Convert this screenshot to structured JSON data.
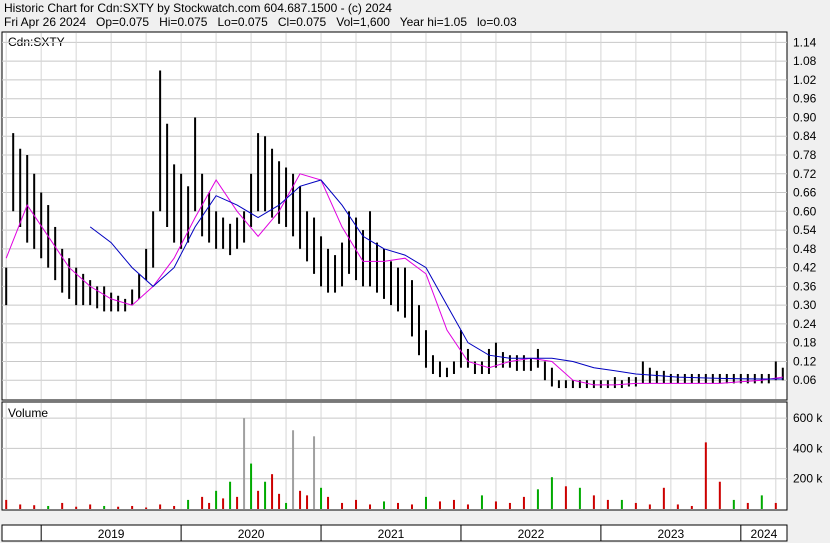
{
  "header": {
    "line1": "Historic Chart for Cdn:SXTY by Stockwatch.com 604.687.1500 - (c) 2024",
    "line2": "Fri Apr 26 2024   Op=0.075   Hi=0.075   Lo=0.075   Cl=0.075   Vol=1,600   Year hi=1.05   lo=0.03"
  },
  "chart_data": [
    {
      "type": "line",
      "title": "Cdn:SXTY",
      "ylim": [
        0.0,
        1.17
      ],
      "y_ticks": [
        "1.14",
        "1.08",
        "1.02",
        "0.96",
        "0.90",
        "0.84",
        "0.78",
        "0.72",
        "0.66",
        "0.60",
        "0.54",
        "0.48",
        "0.42",
        "0.36",
        "0.30",
        "0.24",
        "0.18",
        "0.12",
        "0.06"
      ],
      "x_ticks": [
        "2019",
        "2020",
        "2021",
        "2022",
        "2023",
        "2024"
      ],
      "x_range_years": [
        2018.72,
        2024.33
      ],
      "grid": true,
      "series": [
        {
          "style": "ohlc-bar",
          "color": "#000000",
          "x": [
            2018.75,
            2018.8,
            2018.85,
            2018.9,
            2018.95,
            2019.0,
            2019.05,
            2019.1,
            2019.15,
            2019.2,
            2019.25,
            2019.3,
            2019.35,
            2019.4,
            2019.45,
            2019.5,
            2019.55,
            2019.6,
            2019.65,
            2019.7,
            2019.75,
            2019.8,
            2019.85,
            2019.9,
            2019.95,
            2020.0,
            2020.05,
            2020.1,
            2020.15,
            2020.2,
            2020.25,
            2020.3,
            2020.35,
            2020.4,
            2020.45,
            2020.5,
            2020.55,
            2020.6,
            2020.65,
            2020.7,
            2020.75,
            2020.8,
            2020.85,
            2020.9,
            2020.95,
            2021.0,
            2021.05,
            2021.1,
            2021.15,
            2021.2,
            2021.25,
            2021.3,
            2021.35,
            2021.4,
            2021.45,
            2021.5,
            2021.55,
            2021.6,
            2021.65,
            2021.7,
            2021.75,
            2021.8,
            2021.85,
            2021.9,
            2021.95,
            2022.0,
            2022.05,
            2022.1,
            2022.15,
            2022.2,
            2022.25,
            2022.3,
            2022.35,
            2022.4,
            2022.45,
            2022.5,
            2022.55,
            2022.6,
            2022.65,
            2022.7,
            2022.75,
            2022.8,
            2022.85,
            2022.9,
            2022.95,
            2023.0,
            2023.05,
            2023.1,
            2023.15,
            2023.2,
            2023.25,
            2023.3,
            2023.35,
            2023.4,
            2023.45,
            2023.5,
            2023.55,
            2023.6,
            2023.65,
            2023.7,
            2023.75,
            2023.8,
            2023.85,
            2023.9,
            2023.95,
            2024.0,
            2024.05,
            2024.1,
            2024.15,
            2024.2,
            2024.25,
            2024.3
          ],
          "high": [
            0.42,
            0.85,
            0.8,
            0.78,
            0.72,
            0.66,
            0.62,
            0.55,
            0.48,
            0.45,
            0.42,
            0.4,
            0.38,
            0.36,
            0.36,
            0.34,
            0.33,
            0.32,
            0.35,
            0.4,
            0.48,
            0.6,
            1.05,
            0.88,
            0.75,
            0.72,
            0.68,
            0.9,
            0.72,
            0.66,
            0.6,
            0.58,
            0.56,
            0.58,
            0.6,
            0.72,
            0.85,
            0.84,
            0.8,
            0.76,
            0.74,
            0.72,
            0.68,
            0.6,
            0.58,
            0.52,
            0.48,
            0.46,
            0.5,
            0.6,
            0.58,
            0.54,
            0.6,
            0.5,
            0.48,
            0.44,
            0.42,
            0.42,
            0.38,
            0.3,
            0.22,
            0.14,
            0.12,
            0.1,
            0.12,
            0.22,
            0.16,
            0.12,
            0.12,
            0.16,
            0.18,
            0.15,
            0.14,
            0.14,
            0.14,
            0.13,
            0.16,
            0.12,
            0.1,
            0.06,
            0.06,
            0.06,
            0.06,
            0.06,
            0.06,
            0.06,
            0.06,
            0.07,
            0.06,
            0.07,
            0.07,
            0.12,
            0.1,
            0.09,
            0.09,
            0.08,
            0.08,
            0.08,
            0.08,
            0.08,
            0.08,
            0.08,
            0.08,
            0.08,
            0.08,
            0.08,
            0.08,
            0.08,
            0.08,
            0.08,
            0.12,
            0.1
          ],
          "low": [
            0.3,
            0.6,
            0.55,
            0.5,
            0.48,
            0.45,
            0.42,
            0.38,
            0.34,
            0.32,
            0.3,
            0.3,
            0.3,
            0.29,
            0.28,
            0.28,
            0.28,
            0.28,
            0.3,
            0.32,
            0.38,
            0.42,
            0.6,
            0.55,
            0.5,
            0.48,
            0.5,
            0.6,
            0.52,
            0.5,
            0.48,
            0.48,
            0.46,
            0.48,
            0.5,
            0.55,
            0.6,
            0.6,
            0.58,
            0.56,
            0.55,
            0.52,
            0.48,
            0.44,
            0.4,
            0.36,
            0.34,
            0.34,
            0.36,
            0.4,
            0.38,
            0.36,
            0.36,
            0.34,
            0.32,
            0.3,
            0.28,
            0.26,
            0.2,
            0.14,
            0.1,
            0.08,
            0.07,
            0.07,
            0.08,
            0.1,
            0.1,
            0.08,
            0.08,
            0.08,
            0.1,
            0.1,
            0.1,
            0.09,
            0.09,
            0.09,
            0.1,
            0.06,
            0.04,
            0.035,
            0.035,
            0.035,
            0.035,
            0.035,
            0.035,
            0.035,
            0.035,
            0.035,
            0.035,
            0.04,
            0.04,
            0.05,
            0.05,
            0.05,
            0.05,
            0.05,
            0.05,
            0.05,
            0.05,
            0.05,
            0.05,
            0.05,
            0.05,
            0.05,
            0.05,
            0.05,
            0.05,
            0.05,
            0.05,
            0.05,
            0.06,
            0.06
          ]
        },
        {
          "style": "line",
          "color": "#e000e0",
          "x": [
            2018.75,
            2018.9,
            2019.05,
            2019.2,
            2019.35,
            2019.5,
            2019.65,
            2019.8,
            2019.95,
            2020.1,
            2020.25,
            2020.4,
            2020.55,
            2020.7,
            2020.85,
            2021.0,
            2021.15,
            2021.3,
            2021.45,
            2021.6,
            2021.75,
            2021.9,
            2022.05,
            2022.2,
            2022.35,
            2022.5,
            2022.65,
            2022.8,
            2022.95,
            2023.1,
            2023.25,
            2023.4,
            2023.55,
            2023.7,
            2023.85,
            2024.0,
            2024.15,
            2024.3
          ],
          "values": [
            0.45,
            0.62,
            0.52,
            0.42,
            0.36,
            0.32,
            0.3,
            0.36,
            0.45,
            0.58,
            0.7,
            0.6,
            0.52,
            0.6,
            0.72,
            0.7,
            0.55,
            0.44,
            0.44,
            0.45,
            0.4,
            0.22,
            0.12,
            0.1,
            0.12,
            0.13,
            0.12,
            0.06,
            0.045,
            0.045,
            0.05,
            0.05,
            0.05,
            0.05,
            0.05,
            0.055,
            0.06,
            0.07
          ]
        },
        {
          "style": "line",
          "color": "#0000c0",
          "x": [
            2019.35,
            2019.5,
            2019.65,
            2019.8,
            2019.95,
            2020.1,
            2020.25,
            2020.4,
            2020.55,
            2020.7,
            2020.85,
            2021.0,
            2021.15,
            2021.3,
            2021.45,
            2021.6,
            2021.75,
            2021.9,
            2022.05,
            2022.2,
            2022.35,
            2022.5,
            2022.65,
            2022.8,
            2022.95,
            2023.1,
            2023.25,
            2023.4,
            2023.55,
            2023.7,
            2023.85,
            2024.0,
            2024.15,
            2024.3
          ],
          "values": [
            0.55,
            0.5,
            0.42,
            0.36,
            0.42,
            0.55,
            0.65,
            0.62,
            0.58,
            0.62,
            0.68,
            0.7,
            0.62,
            0.52,
            0.48,
            0.46,
            0.42,
            0.3,
            0.18,
            0.14,
            0.13,
            0.13,
            0.13,
            0.12,
            0.1,
            0.09,
            0.08,
            0.075,
            0.07,
            0.068,
            0.066,
            0.065,
            0.064,
            0.064
          ]
        }
      ]
    },
    {
      "type": "bar",
      "title": "Volume",
      "ylim": [
        0,
        700
      ],
      "y_ticks": [
        "600 k",
        "400 k",
        "200 k"
      ],
      "x_range_years": [
        2018.72,
        2024.33
      ],
      "grid": true,
      "series": [
        {
          "name": "",
          "style": "volume",
          "x": [
            2018.75,
            2018.85,
            2018.95,
            2019.05,
            2019.15,
            2019.25,
            2019.35,
            2019.45,
            2019.55,
            2019.65,
            2019.75,
            2019.85,
            2019.95,
            2020.05,
            2020.15,
            2020.2,
            2020.25,
            2020.3,
            2020.35,
            2020.4,
            2020.45,
            2020.5,
            2020.55,
            2020.6,
            2020.65,
            2020.7,
            2020.75,
            2020.8,
            2020.85,
            2020.9,
            2020.95,
            2021.0,
            2021.05,
            2021.15,
            2021.25,
            2021.35,
            2021.45,
            2021.55,
            2021.65,
            2021.75,
            2021.85,
            2021.95,
            2022.05,
            2022.15,
            2022.25,
            2022.35,
            2022.45,
            2022.55,
            2022.65,
            2022.75,
            2022.85,
            2022.95,
            2023.05,
            2023.15,
            2023.25,
            2023.35,
            2023.45,
            2023.55,
            2023.65,
            2023.75,
            2023.85,
            2023.95,
            2024.05,
            2024.15,
            2024.25
          ],
          "values": [
            60,
            30,
            25,
            20,
            40,
            15,
            30,
            20,
            15,
            20,
            10,
            30,
            20,
            60,
            80,
            40,
            120,
            70,
            180,
            80,
            600,
            300,
            120,
            180,
            230,
            100,
            40,
            520,
            120,
            90,
            480,
            140,
            80,
            40,
            60,
            30,
            50,
            40,
            30,
            80,
            50,
            60,
            30,
            90,
            50,
            40,
            80,
            130,
            210,
            150,
            140,
            90,
            60,
            60,
            40,
            30,
            140,
            30,
            20,
            440,
            180,
            60,
            40,
            90,
            40
          ],
          "colors": [
            "#cc0000",
            "#cc0000",
            "#cc0000",
            "#00aa00",
            "#cc0000",
            "#cc0000",
            "#cc0000",
            "#00aa00",
            "#cc0000",
            "#cc0000",
            "#cc0000",
            "#cc0000",
            "#cc0000",
            "#00aa00",
            "#cc0000",
            "#cc0000",
            "#00aa00",
            "#cc0000",
            "#00aa00",
            "#cc0000",
            "#a0a0a0",
            "#00aa00",
            "#cc0000",
            "#00aa00",
            "#cc0000",
            "#cc0000",
            "#00aa00",
            "#a0a0a0",
            "#cc0000",
            "#cc0000",
            "#a0a0a0",
            "#00aa00",
            "#cc0000",
            "#cc0000",
            "#cc0000",
            "#cc0000",
            "#00aa00",
            "#cc0000",
            "#cc0000",
            "#00aa00",
            "#cc0000",
            "#cc0000",
            "#cc0000",
            "#00aa00",
            "#cc0000",
            "#cc0000",
            "#cc0000",
            "#00aa00",
            "#00aa00",
            "#cc0000",
            "#00aa00",
            "#cc0000",
            "#cc0000",
            "#00aa00",
            "#cc0000",
            "#cc0000",
            "#cc0000",
            "#cc0000",
            "#cc0000",
            "#cc0000",
            "#cc0000",
            "#00aa00",
            "#cc0000",
            "#00aa00",
            "#cc0000"
          ]
        }
      ]
    }
  ]
}
